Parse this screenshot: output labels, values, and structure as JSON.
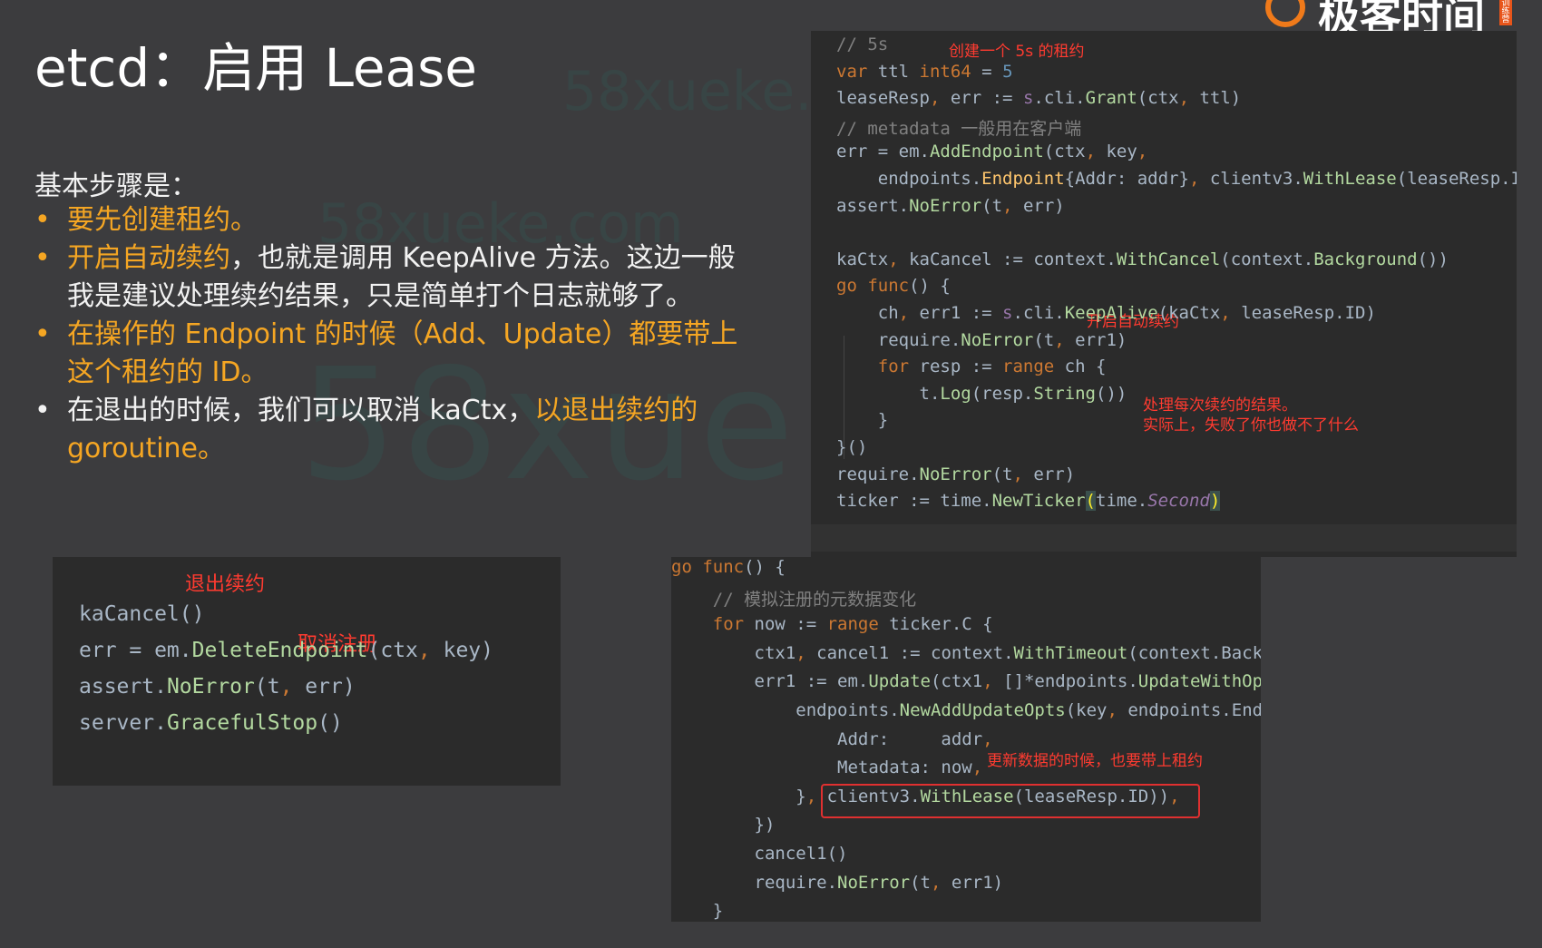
{
  "slide": {
    "title": "etcd：启用 Lease",
    "logo_text": "极客时间",
    "logo_tag": "训练营",
    "watermark": "58xueke.com",
    "steps_title": "基本步骤是：",
    "bullets": [
      {
        "parts": [
          {
            "text": "要先创建租约。",
            "color": "orange"
          }
        ]
      },
      {
        "parts": [
          {
            "text": "开启自动续约",
            "color": "orange"
          },
          {
            "text": "，也就是调用 KeepAlive 方法。这边一般我是建议处理续约结果，只是简单打个日志就够了。",
            "color": "white"
          }
        ]
      },
      {
        "parts": [
          {
            "text": "在操作的 Endpoint 的时候（Add、Update）都要带上这个租约的 ID。",
            "color": "orange"
          }
        ]
      },
      {
        "parts": [
          {
            "text": "在退出的时候，我们可以取消 kaCtx，",
            "color": "white"
          },
          {
            "text": "以退出续约的 goroutine。",
            "color": "orange"
          }
        ]
      }
    ],
    "bullet_dot": "•"
  },
  "code_top": {
    "lines": [
      [
        [
          "cm",
          "// 5s"
        ]
      ],
      [
        [
          "kw",
          "var "
        ],
        [
          "pk",
          "ttl "
        ],
        [
          "kw",
          "int64 "
        ],
        [
          "pk",
          "= "
        ],
        [
          "num",
          "5"
        ]
      ],
      [
        [
          "pk",
          "leaseResp"
        ],
        [
          "kw",
          ", "
        ],
        [
          "pk",
          "err "
        ],
        [
          "pk",
          ":= "
        ],
        [
          "purple",
          "s"
        ],
        [
          "pk",
          ".cli."
        ],
        [
          "meth",
          "Grant"
        ],
        [
          "pk",
          "(ctx"
        ],
        [
          "kw",
          ", "
        ],
        [
          "pk",
          "ttl)"
        ]
      ],
      [
        [
          "cm",
          "// metadata 一般用在客户端"
        ]
      ],
      [
        [
          "pk",
          "err = em."
        ],
        [
          "meth",
          "AddEndpoint"
        ],
        [
          "pk",
          "(ctx"
        ],
        [
          "kw",
          ", "
        ],
        [
          "pk",
          "key"
        ],
        [
          "kw",
          ","
        ]
      ],
      [
        [
          "pk",
          "    endpoints."
        ],
        [
          "fn",
          "Endpoint"
        ],
        [
          "pk",
          "{Addr: addr}"
        ],
        [
          "kw",
          ", "
        ],
        [
          "pk",
          "clientv3."
        ],
        [
          "meth",
          "WithLease"
        ],
        [
          "pk",
          "(leaseResp.ID))"
        ]
      ],
      [
        [
          "pk",
          "assert."
        ],
        [
          "meth",
          "NoError"
        ],
        [
          "pk",
          "(t"
        ],
        [
          "kw",
          ", "
        ],
        [
          "pk",
          "err)"
        ]
      ],
      [],
      [
        [
          "pk",
          "kaCtx"
        ],
        [
          "kw",
          ", "
        ],
        [
          "pk",
          "kaCancel := context."
        ],
        [
          "meth",
          "WithCancel"
        ],
        [
          "pk",
          "(context."
        ],
        [
          "meth",
          "Background"
        ],
        [
          "pk",
          "())"
        ]
      ],
      [
        [
          "kw",
          "go func"
        ],
        [
          "pk",
          "() {"
        ]
      ],
      [
        [
          "pk",
          "    ch"
        ],
        [
          "kw",
          ", "
        ],
        [
          "pk",
          "err1 := "
        ],
        [
          "purple",
          "s"
        ],
        [
          "pk",
          ".cli."
        ],
        [
          "meth",
          "KeepAlive"
        ],
        [
          "pk",
          "(kaCtx"
        ],
        [
          "kw",
          ", "
        ],
        [
          "pk",
          "leaseResp.ID)"
        ]
      ],
      [
        [
          "pk",
          "    require."
        ],
        [
          "meth",
          "NoError"
        ],
        [
          "pk",
          "(t"
        ],
        [
          "kw",
          ", "
        ],
        [
          "pk",
          "err1)"
        ]
      ],
      [
        [
          "kw",
          "    for "
        ],
        [
          "pk",
          "resp := "
        ],
        [
          "kw",
          "range "
        ],
        [
          "pk",
          "ch {"
        ]
      ],
      [
        [
          "pk",
          "        t."
        ],
        [
          "meth",
          "Log"
        ],
        [
          "pk",
          "(resp."
        ],
        [
          "meth",
          "String"
        ],
        [
          "pk",
          "())"
        ]
      ],
      [
        [
          "pk",
          "    }"
        ]
      ],
      [
        [
          "pk",
          "}()"
        ]
      ],
      [
        [
          "pk",
          "require."
        ],
        [
          "meth",
          "NoError"
        ],
        [
          "pk",
          "(t"
        ],
        [
          "kw",
          ", "
        ],
        [
          "pk",
          "err)"
        ]
      ],
      [
        [
          "pk",
          "ticker := time."
        ],
        [
          "meth",
          "NewTicker"
        ],
        [
          "bracket",
          "("
        ],
        [
          "pk",
          "time."
        ],
        [
          "it",
          "Second"
        ],
        [
          "bracket",
          ")"
        ]
      ]
    ],
    "annotations": {
      "create_lease": "创建一个 5s 的租约",
      "auto_renew": "开启自动续约",
      "handle_result_1": "处理每次续约的结果。",
      "handle_result_2": "实际上，失败了你也做不了什么"
    }
  },
  "code_exit": {
    "lines": [
      [
        [
          "pk",
          "kaCancel()"
        ]
      ],
      [
        [
          "pk",
          "err = em."
        ],
        [
          "meth",
          "DeleteEndpoint"
        ],
        [
          "pk",
          "(ctx"
        ],
        [
          "kw",
          ", "
        ],
        [
          "pk",
          "key)"
        ]
      ],
      [
        [
          "pk",
          "assert."
        ],
        [
          "meth",
          "NoError"
        ],
        [
          "pk",
          "(t"
        ],
        [
          "kw",
          ", "
        ],
        [
          "pk",
          "err)"
        ]
      ],
      [
        [
          "pk",
          "server."
        ],
        [
          "meth",
          "GracefulStop"
        ],
        [
          "pk",
          "()"
        ]
      ]
    ],
    "annotations": {
      "exit_renew": "退出续约",
      "cancel_register": "取消注册"
    }
  },
  "code_update": {
    "lines": [
      [
        [
          "kw",
          "go func"
        ],
        [
          "pk",
          "() {"
        ]
      ],
      [
        [
          "cm",
          "    // 模拟注册的元数据变化"
        ]
      ],
      [
        [
          "kw",
          "    for "
        ],
        [
          "pk",
          "now := "
        ],
        [
          "kw",
          "range "
        ],
        [
          "pk",
          "ticker.C {"
        ]
      ],
      [
        [
          "pk",
          "        ctx1"
        ],
        [
          "kw",
          ", "
        ],
        [
          "pk",
          "cancel1 := context."
        ],
        [
          "meth",
          "WithTimeout"
        ],
        [
          "pk",
          "(context.Background()"
        ]
      ],
      [
        [
          "pk",
          "        err1 := em."
        ],
        [
          "meth",
          "Update"
        ],
        [
          "pk",
          "(ctx1"
        ],
        [
          "kw",
          ", "
        ],
        [
          "pk",
          "[]*endpoints."
        ],
        [
          "meth",
          "UpdateWithOpts"
        ]
      ],
      [
        [
          "pk",
          "            endpoints."
        ],
        [
          "meth",
          "NewAddUpdateOpts"
        ],
        [
          "pk",
          "(key"
        ],
        [
          "kw",
          ", "
        ],
        [
          "pk",
          "endpoints.Endpoint{"
        ]
      ],
      [
        [
          "pk",
          "                Addr:     addr"
        ],
        [
          "kw",
          ","
        ]
      ],
      [
        [
          "pk",
          "                Metadata: now"
        ],
        [
          "kw",
          ","
        ]
      ],
      [
        [
          "pk",
          "            }"
        ],
        [
          "kw",
          ", "
        ],
        [
          "pk",
          "clientv3."
        ],
        [
          "meth",
          "WithLease"
        ],
        [
          "pk",
          "(leaseResp.ID))"
        ],
        [
          "kw",
          ","
        ]
      ],
      [
        [
          "pk",
          "        })"
        ]
      ],
      [
        [
          "pk",
          "        cancel1()"
        ]
      ],
      [
        [
          "pk",
          "        require."
        ],
        [
          "meth",
          "NoError"
        ],
        [
          "pk",
          "(t"
        ],
        [
          "kw",
          ", "
        ],
        [
          "pk",
          "err1)"
        ]
      ],
      [
        [
          "pk",
          "    }"
        ]
      ]
    ],
    "annotations": {
      "update_lease": "更新数据的时候，也要带上租约"
    }
  }
}
